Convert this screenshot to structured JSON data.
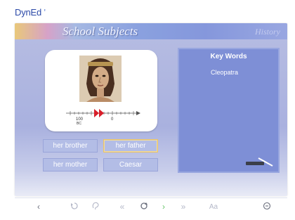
{
  "logo": {
    "text_main": "DynEd",
    "accent_char": "'"
  },
  "header": {
    "title": "School Subjects",
    "section": "History"
  },
  "timeline": {
    "left_label_top": "100",
    "left_label_bottom": "BC",
    "right_label": "0"
  },
  "answers": [
    {
      "label": "her brother",
      "selected": false
    },
    {
      "label": "her father",
      "selected": true
    },
    {
      "label": "her mother",
      "selected": false
    },
    {
      "label": "Caesar",
      "selected": false
    }
  ],
  "keywords": {
    "title": "Key Words",
    "items": [
      "Cleopatra"
    ]
  },
  "toolbar": {
    "back": "‹",
    "font_size_label": "Aa"
  },
  "colors": {
    "accent_gold": "#e9c36a",
    "panel_blue": "#7e8fd6",
    "button_blue": "#b3bde6"
  }
}
